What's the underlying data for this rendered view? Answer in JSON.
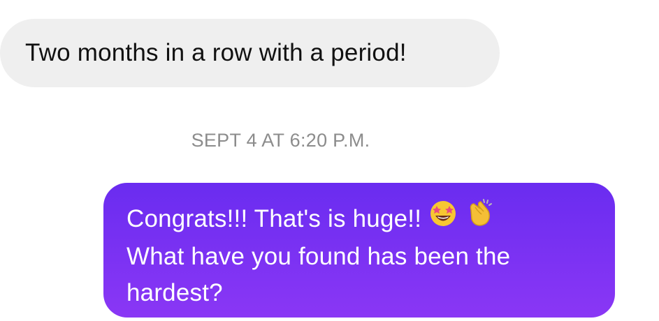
{
  "messages": [
    {
      "direction": "received",
      "text": "Two months in a row with a period!"
    },
    {
      "direction": "sent",
      "lines": [
        "Congrats!!! That's is huge!!",
        "What have you found has been the",
        "hardest?"
      ],
      "emoji": [
        "star-struck-emoji-icon",
        "clapping-hands-emoji-icon"
      ]
    }
  ],
  "timestamp": "SEPT 4 AT 6:20 P.M.",
  "colors": {
    "received_bubble": "#efefef",
    "received_text": "#111111",
    "sent_gradient_start": "#6a2cf0",
    "sent_gradient_end": "#8a37f5",
    "sent_text": "#ffffff",
    "timestamp_text": "#8c8c8c"
  }
}
